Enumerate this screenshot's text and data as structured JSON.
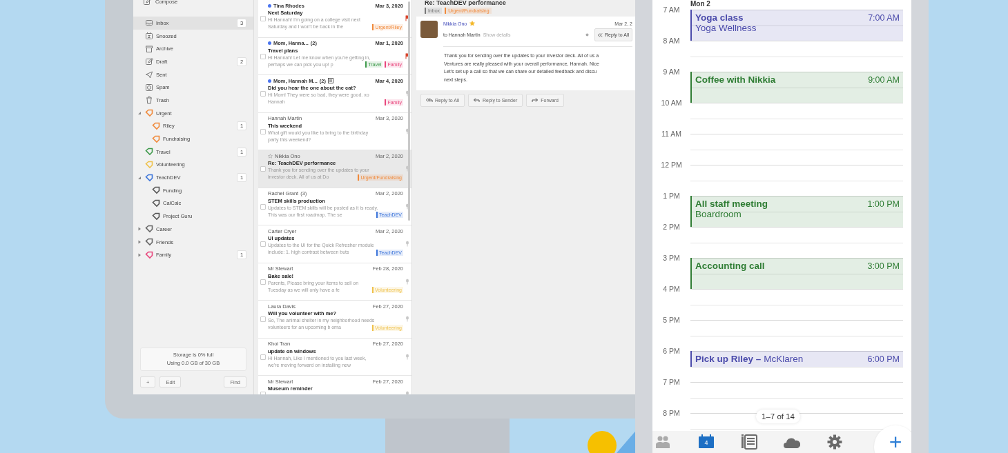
{
  "mail": {
    "sidebar": {
      "compose": "Compose",
      "folders": [
        {
          "kind": "inbox",
          "label": "Inbox",
          "count": "3",
          "selected": true
        },
        {
          "kind": "snoozed",
          "label": "Snoozed",
          "selected": false
        },
        {
          "kind": "archive",
          "label": "Archive",
          "selected": false
        },
        {
          "kind": "draft",
          "label": "Draft",
          "count": "2",
          "selected": false
        },
        {
          "kind": "sent",
          "label": "Sent",
          "selected": false
        },
        {
          "kind": "spam",
          "label": "Spam",
          "selected": false
        },
        {
          "kind": "trash",
          "label": "Trash",
          "selected": false
        }
      ],
      "labels": [
        {
          "label": "Urgent",
          "color": "#f0893a",
          "expanded": true,
          "selected": false,
          "children": [
            {
              "label": "Riley",
              "color": "#f0893a",
              "count": "1",
              "selected": false
            },
            {
              "label": "Fundraising",
              "color": "#f0893a",
              "selected": false
            }
          ]
        },
        {
          "label": "Travel",
          "color": "#3f9a4c",
          "count": "1",
          "selected": false
        },
        {
          "label": "Volunteering",
          "color": "#efc14a",
          "selected": false
        },
        {
          "label": "TeachDEV",
          "color": "#3b74d9",
          "count": "1",
          "expanded": true,
          "selected": false,
          "children": [
            {
              "label": "Funding",
              "color": "#555555",
              "selected": false
            },
            {
              "label": "CalCalc",
              "color": "#555555",
              "selected": false
            },
            {
              "label": "Project Guru",
              "color": "#555555",
              "selected": false
            }
          ]
        },
        {
          "label": "Career",
          "color": "#666666",
          "expanded": false,
          "selected": false
        },
        {
          "label": "Friends",
          "color": "#666666",
          "expanded": false,
          "selected": false
        },
        {
          "label": "Family",
          "color": "#e8467c",
          "count": "1",
          "expanded": false,
          "selected": false
        }
      ],
      "storage": [
        "Storage is 0% full",
        "Using 0.0 GB of 30 GB"
      ],
      "buttons": [
        "+",
        "Edit",
        "Find"
      ]
    },
    "messages": [
      {
        "sender": "Tina Rhodes",
        "date": "Mar 3, 2020",
        "subject": "Next Saturday",
        "preview": [
          "Hi Hannah! I'm going on a college visit next",
          "Saturday and I won't be back in the"
        ],
        "tags": [
          {
            "label": "Urgent/Riley",
            "color": "#f0893a"
          }
        ],
        "unread": true,
        "flagged": true,
        "checked": false,
        "selected": false
      },
      {
        "sender": "Mom, Hanna...",
        "count": "(2)",
        "date": "Mar 1, 2020",
        "subject": "Travel plans",
        "preview": [
          "Hi Hannah! Let me know when you're getting in,",
          "perhaps we can pick you up! p"
        ],
        "tags": [
          {
            "label": "Travel",
            "color": "#3f9a4c"
          },
          {
            "label": "Family",
            "color": "#e8467c"
          }
        ],
        "unread": true,
        "flagged": true,
        "checked": false,
        "selected": false
      },
      {
        "sender": "Mom, Hannah M...",
        "count": "(2)",
        "attachment": true,
        "date": "Mar 4, 2020",
        "subject": "Did you hear the one about the cat?",
        "preview": [
          "Hi Mom! They were so bad, they were good. xo",
          "Hannah"
        ],
        "tags": [
          {
            "label": "Family",
            "color": "#e8467c"
          }
        ],
        "unread": true,
        "flagged": false,
        "checked": false,
        "selected": false
      },
      {
        "sender": "Hannah Martin",
        "date": "Mar 3, 2020",
        "subject": "This weekend",
        "preview": [
          "What gift would you like to bring to the birthday",
          "party this weekend?"
        ],
        "unread": false,
        "flagged": false,
        "checked": false,
        "selected": false
      },
      {
        "sender": "Nikkia Ono",
        "starred": false,
        "date": "Mar 2, 2020",
        "subject": "Re: TeachDEV performance",
        "preview": [
          "Thank you for sending over the updates to your",
          "investor deck. All of us at Do"
        ],
        "tags": [
          {
            "label": "Urgent/Fundraising",
            "color": "#f0893a"
          }
        ],
        "unread": false,
        "flagged": false,
        "checked": false,
        "selected": true
      },
      {
        "sender": "Rachel Grant",
        "count": "(3)",
        "date": "Mar 2, 2020",
        "subject": "STEM skills production",
        "preview": [
          "Updates to STEM skills will be posted as it is ready.",
          "This was our first roadmap. The se"
        ],
        "tags": [
          {
            "label": "TeachDEV",
            "color": "#3b74d9"
          }
        ],
        "unread": false,
        "flagged": false,
        "checked": false,
        "selected": false
      },
      {
        "sender": "Carter Cryer",
        "date": "Mar 2, 2020",
        "subject": "UI updates",
        "preview": [
          "Updates to the UI for the Quick Refresher module",
          "include: 1. high contrast between buts"
        ],
        "tags": [
          {
            "label": "TeachDEV",
            "color": "#3b74d9"
          }
        ],
        "unread": false,
        "flagged": false,
        "checked": false,
        "selected": false
      },
      {
        "sender": "Mr Stewart",
        "date": "Feb 28, 2020",
        "subject": "Bake sale!",
        "preview": [
          "Parents, Please bring your items to sell on",
          "Tuesday as we will only have a fe"
        ],
        "tags": [
          {
            "label": "Volunteering",
            "color": "#efc14a"
          }
        ],
        "unread": false,
        "flagged": false,
        "checked": false,
        "selected": false
      },
      {
        "sender": "Laura Davis",
        "date": "Feb 27, 2020",
        "subject": "Will you volunteer with me?",
        "preview": [
          "So, The animal shelter in my neighborhood needs",
          "volunteers for an upcoming b oma"
        ],
        "tags": [
          {
            "label": "Volunteering",
            "color": "#efc14a"
          }
        ],
        "unread": false,
        "flagged": false,
        "checked": false,
        "selected": false
      },
      {
        "sender": "Khoi Tran",
        "date": "Feb 27, 2020",
        "subject": "update on windows",
        "preview": [
          "Hi Hannah, Like I mentioned to you last week,",
          "we're moving forward on installing new"
        ],
        "unread": false,
        "flagged": false,
        "checked": false,
        "selected": false
      },
      {
        "sender": "Mr Stewart",
        "date": "Feb 27, 2020",
        "subject": "Museum reminder",
        "unread": false,
        "flagged": false,
        "checked": false,
        "selected": false
      }
    ],
    "reader": {
      "subject": "Re: TeachDEV performance",
      "tags": [
        {
          "label": "Inbox",
          "color": "#777777"
        },
        {
          "label": "Urgent/Fundraising",
          "color": "#f0893a"
        }
      ],
      "sender": "Nikkia Ono",
      "starred": true,
      "to": "to Hannah Martin",
      "details": "Show details",
      "date": "Mar 2, 2",
      "reply_all": "Reply to All",
      "body": [
        "Thank you for sending over the updates to your investor deck. All of us a",
        "Ventures are really pleased with your overall performance, Hannah. Nice",
        "Let's set up a call so that we can share our detailed feedback and discu",
        "next steps."
      ],
      "buttons": [
        "Reply to All",
        "Reply to Sender",
        "Forward"
      ]
    }
  },
  "calendar": {
    "day": "Mon 2",
    "hours": [
      {
        "label": "7 AM",
        "events": [
          {
            "kind": "full",
            "title": "Yoga class",
            "location": "Yoga Wellness",
            "time": "7:00 AM",
            "color": "#4b4bab"
          }
        ]
      },
      {
        "label": "8 AM"
      },
      {
        "label": "9 AM",
        "events": [
          {
            "kind": "full",
            "title": "Coffee with Nikkia",
            "time": "9:00 AM",
            "color": "#2f7d34"
          }
        ]
      },
      {
        "label": "10 AM"
      },
      {
        "label": "11 AM"
      },
      {
        "label": "12 PM"
      },
      {
        "label": "1 PM",
        "events": [
          {
            "kind": "full",
            "title": "All staff meeting",
            "location": "Boardroom",
            "time": "1:00 PM",
            "color": "#2f7d34"
          }
        ]
      },
      {
        "label": "2 PM"
      },
      {
        "label": "3 PM",
        "events": [
          {
            "kind": "full",
            "title": "Accounting call",
            "time": "3:00 PM",
            "color": "#2f7d34"
          }
        ]
      },
      {
        "label": "4 PM"
      },
      {
        "label": "5 PM"
      },
      {
        "label": "6 PM",
        "events": [
          {
            "kind": "half",
            "title": "Pick up Riley –",
            "location": "McKlaren",
            "time": "6:00 PM",
            "color": "#4b4bab"
          }
        ]
      },
      {
        "label": "7 PM"
      },
      {
        "label": "8 PM"
      }
    ],
    "pager": "1–7 of 14",
    "tabs": [
      {
        "kind": "people",
        "selected": false
      },
      {
        "kind": "calendar",
        "label": "4",
        "selected": true
      },
      {
        "kind": "notes",
        "selected": false
      },
      {
        "kind": "cloud",
        "selected": false
      },
      {
        "kind": "settings",
        "selected": false
      }
    ],
    "add": "+"
  }
}
